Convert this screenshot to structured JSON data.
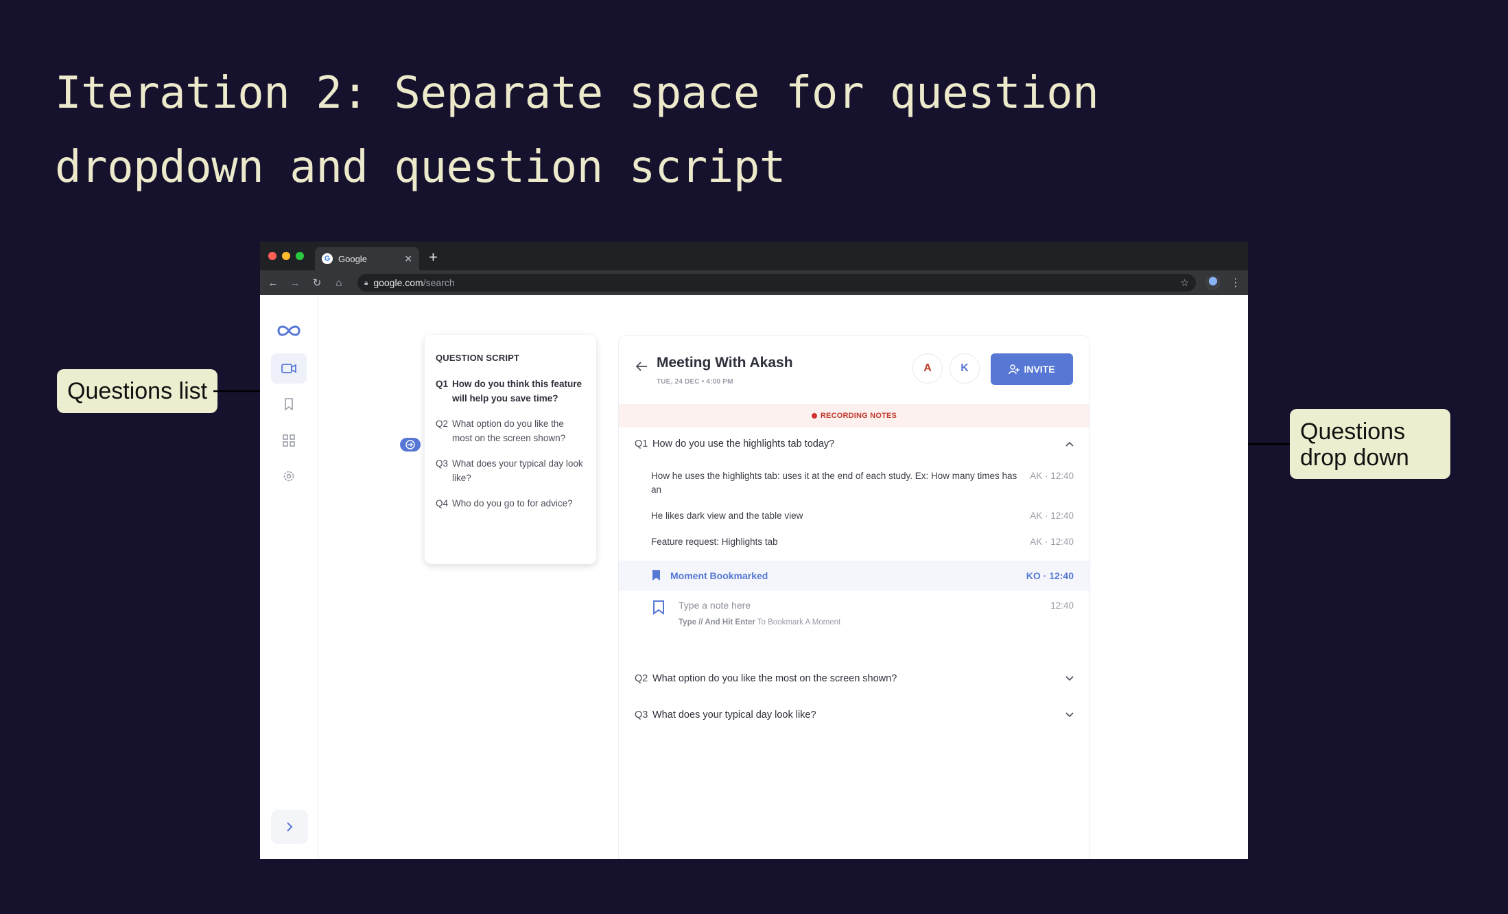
{
  "slide": {
    "title": "Iteration 2: Separate space for question dropdown and question script",
    "callout_left": "Questions list",
    "callout_right": "Questions drop down"
  },
  "browser": {
    "tab_title": "Google",
    "url_host": "google.com",
    "url_path": "/search"
  },
  "sidebar": {
    "icons": [
      "infinity-logo-icon",
      "video-camera-icon",
      "bookmark-icon",
      "grid-icon",
      "gear-icon",
      "chevron-right-icon"
    ]
  },
  "script": {
    "title": "QUESTION SCRIPT",
    "questions": [
      {
        "num": "Q1",
        "text": "How do you think this feature will help you save time?"
      },
      {
        "num": "Q2",
        "text": "What option do you like the most on the screen shown?"
      },
      {
        "num": "Q3",
        "text": "What does your typical day look like?"
      },
      {
        "num": "Q4",
        "text": "Who do you go to for advice?"
      }
    ]
  },
  "meeting": {
    "title": "Meeting With Akash",
    "date": "TUE, 24 DEC • 4:00 PM",
    "avatars": [
      {
        "letter": "A",
        "color": "#c0392b"
      },
      {
        "letter": "K",
        "color": "#5678d4"
      }
    ],
    "invite_label": "INVITE",
    "recording_label": "RECORDING NOTES",
    "sections": [
      {
        "num": "Q1",
        "text": "How do you use the highlights tab today?"
      },
      {
        "num": "Q2",
        "text": "What option do you like the most on the screen shown?"
      },
      {
        "num": "Q3",
        "text": "What does your typical day look like?"
      }
    ],
    "notes": [
      {
        "text": "How he uses the highlights tab: uses it at the end of each study. Ex: How many times has an",
        "meta": "AK · 12:40"
      },
      {
        "text": "He likes dark view and the table view",
        "meta": "AK · 12:40"
      },
      {
        "text": "Feature request: Highlights tab",
        "meta": "AK · 12:40"
      }
    ],
    "bookmark": {
      "label": "Moment Bookmarked",
      "meta": "KO · 12:40"
    },
    "note_input": {
      "placeholder": "Type a note here",
      "time": "12:40",
      "hint_bold": "Type // And Hit Enter",
      "hint_rest": " To Bookmark A Moment"
    }
  },
  "colors": {
    "background": "#16112d",
    "accent": "#5678d4",
    "recording": "#c0392b",
    "callout": "#eceecf",
    "title": "#eceacb"
  }
}
